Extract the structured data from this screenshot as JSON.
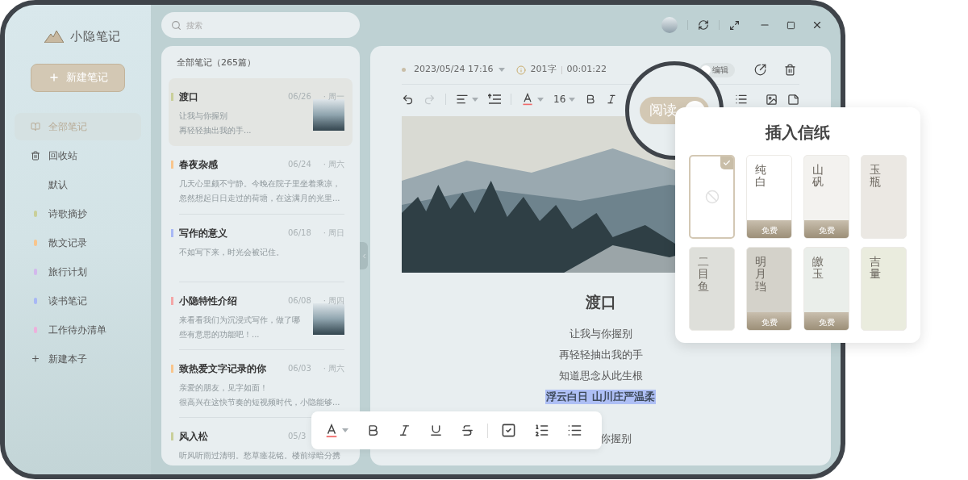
{
  "app": {
    "name": "小隐笔记"
  },
  "new_note_button": {
    "label": "新建笔记"
  },
  "sidebar": {
    "items": [
      {
        "kind": "all",
        "label": "全部笔记",
        "selected": true
      },
      {
        "kind": "trash",
        "label": "回收站",
        "selected": false
      },
      {
        "kind": "notebook",
        "label": "默认",
        "selected": false
      },
      {
        "kind": "notebook",
        "label": "诗歌摘抄",
        "color": "#c9cf9a",
        "selected": false
      },
      {
        "kind": "notebook",
        "label": "散文记录",
        "color": "#f8c58c",
        "selected": false
      },
      {
        "kind": "notebook",
        "label": "旅行计划",
        "color": "#d3b8ec",
        "selected": false
      },
      {
        "kind": "notebook",
        "label": "读书笔记",
        "color": "#a8b8f5",
        "selected": false
      },
      {
        "kind": "notebook",
        "label": "工作待办清单",
        "color": "#eeb0dc",
        "selected": false
      },
      {
        "kind": "add",
        "label": "新建本子",
        "selected": false
      }
    ]
  },
  "search": {
    "placeholder": "搜索"
  },
  "note_list": {
    "heading": "全部笔记（265篇）",
    "notes": [
      {
        "title": "渡口",
        "date": "06/26",
        "weekday": "· 周一",
        "preview": [
          "让我与你握别",
          "再轻轻抽出我的手..."
        ],
        "color": "#c9cf9a",
        "photo": true,
        "selected": true
      },
      {
        "title": "春夜杂感",
        "date": "06/24",
        "weekday": "· 周六",
        "preview": [
          "几天心里颇不宁静。今晚在院子里坐着乘凉，",
          "忽然想起日日走过的荷塘，在这满月的光里..."
        ],
        "color": "#f8c58c",
        "photo": false,
        "selected": false
      },
      {
        "title": "写作的意义",
        "date": "06/18",
        "weekday": "· 周日",
        "preview": [
          "不如写下来，时光会被记住。"
        ],
        "color": "#a8b8f5",
        "photo": false,
        "selected": false
      },
      {
        "title": "小隐特性介绍",
        "date": "06/08",
        "weekday": "· 周四",
        "preview": [
          "来看看我们为沉浸式写作，做了哪",
          "些有意思的功能吧！..."
        ],
        "color": "#f4a6a6",
        "photo": true,
        "selected": false
      },
      {
        "title": "致热爱文字记录的你",
        "date": "06/03",
        "weekday": "· 周六",
        "preview": [
          "亲爱的朋友，见字如面！",
          "很高兴在这快节奏的短视频时代，小隐能够..."
        ],
        "color": "#f8c58c",
        "photo": false,
        "selected": false
      },
      {
        "title": "风入松",
        "date": "05/3",
        "preview": [
          "听风听雨过清明。愁草瘗花铭。楼前绿暗分携"
        ],
        "color": "#c9cf9a",
        "photo": false,
        "selected": false
      }
    ]
  },
  "editor": {
    "date": "2023/05/24 17:16",
    "word_count": "201字",
    "duration": "00:01:22",
    "edit_toggle": {
      "label": "编辑",
      "on": false
    },
    "toolbar": {
      "font_size": "16",
      "redo_disabled": true
    },
    "title": "渡口",
    "lines": [
      {
        "text": "让我与你握别",
        "highlighted": false
      },
      {
        "text": "再轻轻抽出我的手",
        "highlighted": false
      },
      {
        "text": "知道思念从此生根",
        "highlighted": false
      },
      {
        "text": "浮云白日 山川庄严温柔",
        "highlighted": true
      },
      {
        "text": "你握别",
        "highlighted": false
      }
    ]
  },
  "magnifier": {
    "label": "阅读",
    "on": true
  },
  "stationery_popup": {
    "title": "插入信纸",
    "papers": [
      {
        "kind": "none",
        "selected": true
      },
      {
        "kind": "paper",
        "name": "纯白",
        "badge": "免费",
        "color": "#ffffff",
        "selected": false
      },
      {
        "kind": "paper",
        "name": "山矾",
        "badge": "免费",
        "color": "#f3f2ef",
        "selected": false
      },
      {
        "kind": "paper",
        "name": "玉瓶",
        "color": "#ebe8e3",
        "selected": false
      },
      {
        "kind": "paper",
        "name": "二目鱼",
        "color": "#dedfda",
        "selected": false
      },
      {
        "kind": "paper",
        "name": "明月珰",
        "badge": "免费",
        "color": "#d4d2ca",
        "selected": false
      },
      {
        "kind": "paper",
        "name": "皦玉",
        "badge": "免费",
        "color": "#eaeeea",
        "selected": false
      },
      {
        "kind": "paper",
        "name": "吉量",
        "color": "#eaecde",
        "selected": false
      }
    ]
  }
}
